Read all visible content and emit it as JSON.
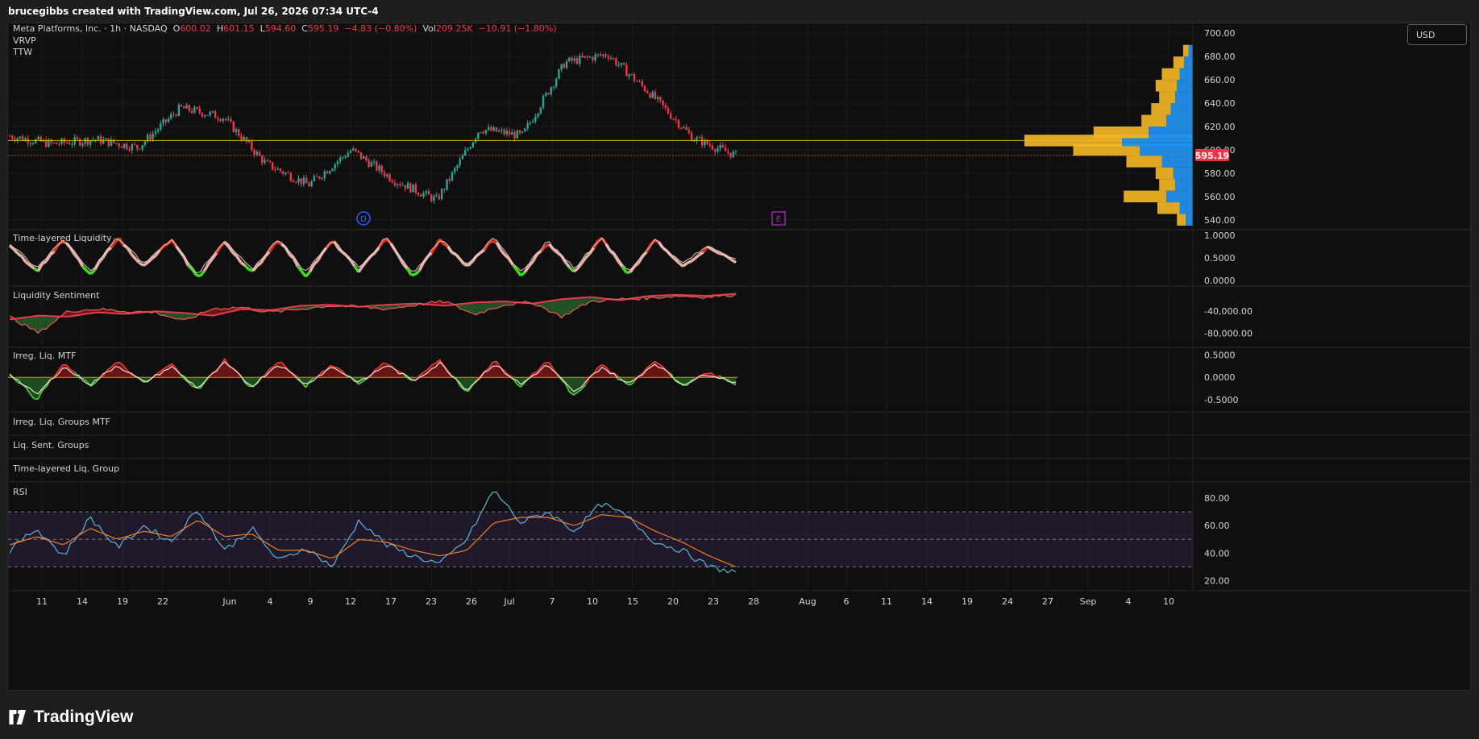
{
  "header": {
    "text": "brucegibbs created with TradingView.com, Jul 26, 2026 07:34 UTC-4"
  },
  "legend": {
    "symbol": "Meta Platforms, Inc. · 1h · NASDAQ",
    "open_label": "O",
    "open": "600.02",
    "high_label": "H",
    "high": "601.15",
    "low_label": "L",
    "low": "594.60",
    "close_label": "C",
    "close": "595.19",
    "change": "−4.83 (−0.80%)",
    "vol_label": "Vol",
    "vol": "209.25K",
    "vol_change": "−10.91 (−1.80%)",
    "ind1": "VRVP",
    "ind2": "TTW"
  },
  "currency_button": "USD",
  "last_price_label": "595.19",
  "footer": {
    "brand": "TradingView"
  },
  "colors": {
    "up": "#26a69a",
    "down": "#f23645",
    "poc_line": "#f5a623",
    "vp_up": "#2196f3",
    "vp_down": "#f7b825",
    "rsi_line": "#5fb3d9",
    "rsi_ma": "#f57c20",
    "rsi_band": "#2a1f3d",
    "bull_fill": "#2e7d32",
    "bear_fill": "#b71c1c"
  },
  "markers": [
    {
      "label": "D",
      "date": "Jun 12",
      "color": "#2962ff"
    },
    {
      "label": "E",
      "date": "Jul 29",
      "color": "#9c27b0"
    }
  ],
  "x_axis": {
    "ticks": [
      "11",
      "14",
      "19",
      "22",
      "Jun",
      "4",
      "9",
      "12",
      "17",
      "23",
      "26",
      "Jul",
      "7",
      "10",
      "15",
      "20",
      "23",
      "28",
      "Aug",
      "6",
      "11",
      "14",
      "19",
      "24",
      "27",
      "Sep",
      "4",
      "10"
    ]
  },
  "chart_data": [
    {
      "type": "candlestick",
      "title": "Meta Platforms, Inc. · 1h · NASDAQ",
      "y_ticks": [
        "700.00",
        "680.00",
        "660.00",
        "640.00",
        "620.00",
        "600.00",
        "580.00",
        "560.00",
        "540.00"
      ],
      "ylim": [
        535,
        705
      ],
      "x": [
        "May 9",
        "May 14",
        "May 19",
        "May 22",
        "Jun 1",
        "Jun 4",
        "Jun 9",
        "Jun 12",
        "Jun 17",
        "Jun 23",
        "Jun 26",
        "Jul 1",
        "Jul 7",
        "Jul 10",
        "Jul 15",
        "Jul 20",
        "Jul 23",
        "Jul 24"
      ],
      "close": [
        612,
        605,
        609,
        602,
        636,
        628,
        588,
        570,
        600,
        574,
        557,
        618,
        612,
        675,
        682,
        648,
        610,
        595.19
      ],
      "poc": 608,
      "last": 595.19,
      "volume_profile": {
        "price": [
          540,
          550,
          560,
          570,
          580,
          590,
          600,
          608,
          615,
          625,
          635,
          645,
          655,
          665,
          675,
          685
        ],
        "up": [
          8,
          15,
          30,
          20,
          22,
          35,
          60,
          80,
          50,
          30,
          25,
          20,
          18,
          15,
          10,
          5
        ],
        "down": [
          10,
          25,
          48,
          18,
          20,
          40,
          75,
          110,
          62,
          28,
          22,
          18,
          24,
          20,
          12,
          6
        ]
      }
    },
    {
      "type": "line",
      "title": "Time-layered Liquidity",
      "y_ticks": [
        "1.0000",
        "0.5000",
        "0.0000"
      ],
      "ylim": [
        -0.05,
        1.05
      ],
      "series": [
        {
          "values": [
            0.8,
            0.2,
            0.9,
            0.1,
            0.95,
            0.3,
            0.9,
            0.05,
            0.85,
            0.15,
            0.92,
            0.1,
            0.88,
            0.2,
            0.95,
            0.05,
            0.9,
            0.3,
            0.92,
            0.1,
            0.85,
            0.2,
            0.95,
            0.1,
            0.9,
            0.3,
            0.75,
            0.4
          ]
        }
      ]
    },
    {
      "type": "area",
      "title": "Liquidity Sentiment",
      "y_ticks": [
        "-40,000.00",
        "-80,000.00"
      ],
      "ylim": [
        -100000,
        0
      ],
      "series": [
        {
          "values": [
            -55000,
            -48000,
            -50000,
            -42000,
            -45000,
            -40000,
            -43000,
            -48000,
            -36000,
            -38000,
            -30000,
            -28000,
            -32000,
            -28000,
            -26000,
            -30000,
            -24000,
            -22000,
            -26000,
            -18000,
            -14000,
            -20000,
            -12000,
            -10000,
            -12000,
            -8000
          ]
        },
        {
          "values": [
            -50000,
            -80000,
            -40000,
            -36000,
            -40000,
            -42000,
            -58000,
            -35000,
            -33000,
            -42000,
            -36000,
            -30000,
            -32000,
            -36000,
            -28000,
            -22000,
            -46000,
            -28000,
            -24000,
            -50000,
            -22000,
            -18000,
            -16000,
            -12000,
            -14000,
            -10000
          ]
        }
      ]
    },
    {
      "type": "area",
      "title": "Irreg. Liq. MTF",
      "y_ticks": [
        "0.5000",
        "0.0000",
        "-0.5000"
      ],
      "ylim": [
        -0.7,
        0.6
      ],
      "series": [
        {
          "values": [
            0.1,
            -0.5,
            0.3,
            -0.2,
            0.35,
            -0.15,
            0.3,
            -0.3,
            0.4,
            -0.25,
            0.38,
            -0.2,
            0.3,
            -0.15,
            0.35,
            -0.1,
            0.4,
            -0.35,
            0.38,
            -0.2,
            0.35,
            -0.45,
            0.3,
            -0.2,
            0.4,
            -0.2,
            0.1,
            -0.15
          ]
        }
      ]
    },
    {
      "type": "line",
      "title": "RSI",
      "y_ticks": [
        "80.00",
        "60.00",
        "40.00",
        "20.00"
      ],
      "ylim": [
        15,
        90
      ],
      "bands": [
        70,
        50,
        30
      ],
      "series": [
        {
          "values": [
            42,
            58,
            38,
            66,
            44,
            60,
            48,
            72,
            42,
            58,
            34,
            44,
            30,
            64,
            46,
            38,
            32,
            50,
            86,
            62,
            70,
            56,
            76,
            66,
            48,
            42,
            30,
            26
          ]
        },
        {
          "values": [
            46,
            52,
            46,
            58,
            50,
            56,
            52,
            64,
            52,
            54,
            42,
            42,
            36,
            50,
            48,
            42,
            38,
            42,
            62,
            66,
            66,
            60,
            68,
            66,
            56,
            48,
            38,
            30
          ]
        }
      ]
    }
  ],
  "indicators_empty": [
    "Irreg. Liq. Groups MTF",
    "Liq. Sent. Groups",
    "Time-layered Liq. Group"
  ]
}
